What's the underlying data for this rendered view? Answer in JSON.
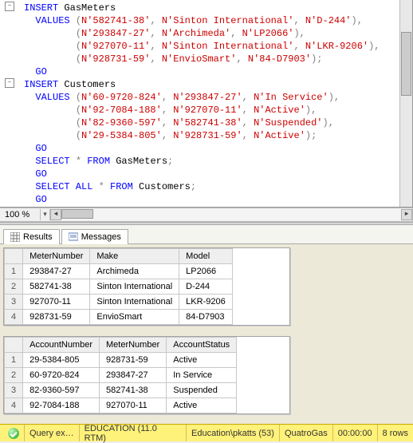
{
  "zoom": "100 %",
  "sql": {
    "lines": [
      {
        "expand": true,
        "tokens": [
          [
            "kw",
            "INSERT"
          ],
          [
            "ident",
            " GasMeters"
          ]
        ]
      },
      {
        "tokens": [
          [
            "kw",
            "  VALUES "
          ],
          [
            "op",
            "("
          ],
          [
            "str",
            "N'582741-38'"
          ],
          [
            "op",
            ", "
          ],
          [
            "str",
            "N'Sinton International'"
          ],
          [
            "op",
            ", "
          ],
          [
            "str",
            "N'D-244'"
          ],
          [
            "op",
            "),"
          ]
        ]
      },
      {
        "tokens": [
          [
            "ident",
            "         "
          ],
          [
            "op",
            "("
          ],
          [
            "str",
            "N'293847-27'"
          ],
          [
            "op",
            ", "
          ],
          [
            "str",
            "N'Archimeda'"
          ],
          [
            "op",
            ", "
          ],
          [
            "str",
            "N'LP2066'"
          ],
          [
            "op",
            "),"
          ]
        ]
      },
      {
        "tokens": [
          [
            "ident",
            "         "
          ],
          [
            "op",
            "("
          ],
          [
            "str",
            "N'927070-11'"
          ],
          [
            "op",
            ", "
          ],
          [
            "str",
            "N'Sinton International'"
          ],
          [
            "op",
            ", "
          ],
          [
            "str",
            "N'LKR-9206'"
          ],
          [
            "op",
            "),"
          ]
        ]
      },
      {
        "tokens": [
          [
            "ident",
            "         "
          ],
          [
            "op",
            "("
          ],
          [
            "str",
            "N'928731-59'"
          ],
          [
            "op",
            ", "
          ],
          [
            "str",
            "N'EnvioSmart'"
          ],
          [
            "op",
            ", "
          ],
          [
            "str",
            "N'84-D7903'"
          ],
          [
            "op",
            ");"
          ]
        ]
      },
      {
        "tokens": [
          [
            "kw",
            "  GO"
          ]
        ]
      },
      {
        "expand": true,
        "tokens": [
          [
            "kw",
            "INSERT"
          ],
          [
            "ident",
            " Customers"
          ]
        ]
      },
      {
        "tokens": [
          [
            "kw",
            "  VALUES "
          ],
          [
            "op",
            "("
          ],
          [
            "str",
            "N'60-9720-824'"
          ],
          [
            "op",
            ", "
          ],
          [
            "str",
            "N'293847-27'"
          ],
          [
            "op",
            ", "
          ],
          [
            "str",
            "N'In Service'"
          ],
          [
            "op",
            "),"
          ]
        ]
      },
      {
        "tokens": [
          [
            "ident",
            "         "
          ],
          [
            "op",
            "("
          ],
          [
            "str",
            "N'92-7084-188'"
          ],
          [
            "op",
            ", "
          ],
          [
            "str",
            "N'927070-11'"
          ],
          [
            "op",
            ", "
          ],
          [
            "str",
            "N'Active'"
          ],
          [
            "op",
            "),"
          ]
        ]
      },
      {
        "tokens": [
          [
            "ident",
            "         "
          ],
          [
            "op",
            "("
          ],
          [
            "str",
            "N'82-9360-597'"
          ],
          [
            "op",
            ", "
          ],
          [
            "str",
            "N'582741-38'"
          ],
          [
            "op",
            ", "
          ],
          [
            "str",
            "N'Suspended'"
          ],
          [
            "op",
            "),"
          ]
        ]
      },
      {
        "tokens": [
          [
            "ident",
            "         "
          ],
          [
            "op",
            "("
          ],
          [
            "str",
            "N'29-5384-805'"
          ],
          [
            "op",
            ", "
          ],
          [
            "str",
            "N'928731-59'"
          ],
          [
            "op",
            ", "
          ],
          [
            "str",
            "N'Active'"
          ],
          [
            "op",
            ");"
          ]
        ]
      },
      {
        "tokens": [
          [
            "kw",
            "  GO"
          ]
        ]
      },
      {
        "tokens": [
          [
            "kw",
            "  SELECT "
          ],
          [
            "op",
            "* "
          ],
          [
            "kw",
            "FROM"
          ],
          [
            "ident",
            " GasMeters"
          ],
          [
            "op",
            ";"
          ]
        ]
      },
      {
        "tokens": [
          [
            "kw",
            "  GO"
          ]
        ]
      },
      {
        "tokens": [
          [
            "kw",
            "  SELECT ALL "
          ],
          [
            "op",
            "* "
          ],
          [
            "kw",
            "FROM"
          ],
          [
            "ident",
            " Customers"
          ],
          [
            "op",
            ";"
          ]
        ]
      },
      {
        "tokens": [
          [
            "kw",
            "  GO"
          ]
        ]
      }
    ]
  },
  "tabs": {
    "results": "Results",
    "messages": "Messages"
  },
  "grid1": {
    "headers": [
      "MeterNumber",
      "Make",
      "Model"
    ],
    "rows": [
      [
        "293847-27",
        "Archimeda",
        "LP2066"
      ],
      [
        "582741-38",
        "Sinton International",
        "D-244"
      ],
      [
        "927070-11",
        "Sinton International",
        "LKR-9206"
      ],
      [
        "928731-59",
        "EnvioSmart",
        "84-D7903"
      ]
    ]
  },
  "grid2": {
    "headers": [
      "AccountNumber",
      "MeterNumber",
      "AccountStatus"
    ],
    "rows": [
      [
        "29-5384-805",
        "928731-59",
        "Active"
      ],
      [
        "60-9720-824",
        "293847-27",
        "In Service"
      ],
      [
        "82-9360-597",
        "582741-38",
        "Suspended"
      ],
      [
        "92-7084-188",
        "927070-11",
        "Active"
      ]
    ]
  },
  "status": {
    "state": "Query ex…",
    "server": "EDUCATION (11.0 RTM)",
    "user": "Education\\pkatts (53)",
    "db": "QuatroGas",
    "time": "00:00:00",
    "rows": "8 rows"
  }
}
